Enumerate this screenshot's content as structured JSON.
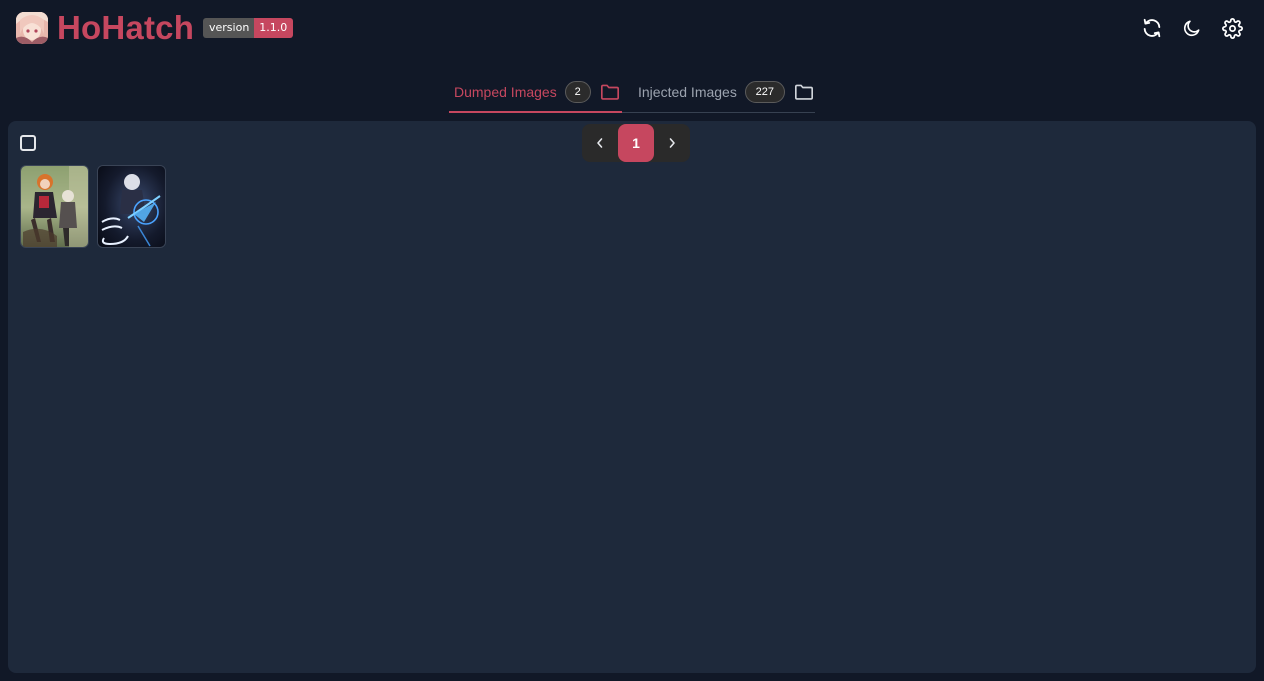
{
  "header": {
    "title": "HoHatch",
    "version_label": "version",
    "version_number": "1.1.0",
    "buttons": [
      {
        "name": "refresh-icon"
      },
      {
        "name": "moon-icon"
      },
      {
        "name": "gear-icon"
      }
    ]
  },
  "tabs": [
    {
      "label": "Dumped Images",
      "count": "2",
      "active": true
    },
    {
      "label": "Injected Images",
      "count": "227",
      "active": false
    }
  ],
  "pagination": {
    "prev": "‹",
    "current_page": "1",
    "next": "›"
  },
  "images": [
    {
      "name": "dumped-image-1"
    },
    {
      "name": "dumped-image-2"
    }
  ],
  "colors": {
    "accent": "#c6475f",
    "background": "#111827",
    "panel": "#1e293b",
    "badge_bg": "#2b2b2b",
    "version_label_bg": "#555555"
  }
}
